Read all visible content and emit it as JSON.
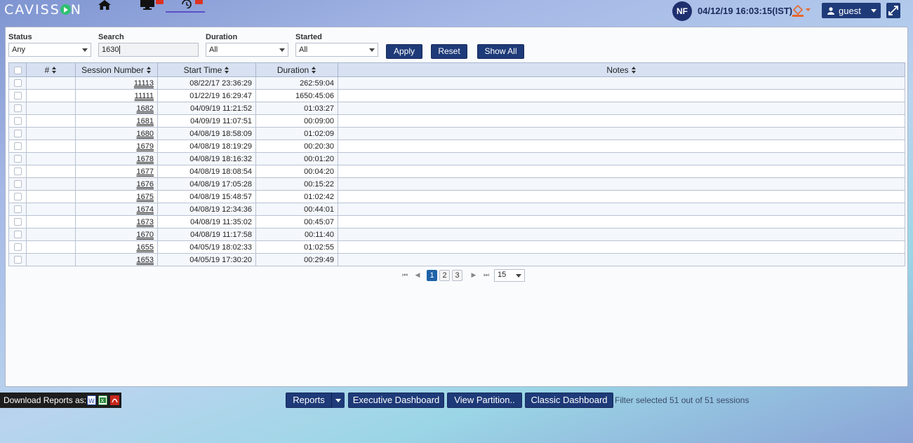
{
  "app": {
    "logo_text": "CAVISS",
    "logo_text_end": "N"
  },
  "header": {
    "avatar_initials": "NF",
    "datetime": "04/12/19 16:03:15(IST)",
    "user_label": "guest"
  },
  "filters": {
    "status": {
      "label": "Status",
      "value": "Any"
    },
    "search": {
      "label": "Search",
      "value": "1630"
    },
    "duration": {
      "label": "Duration",
      "value": "All"
    },
    "started": {
      "label": "Started",
      "value": "All"
    },
    "buttons": {
      "apply": "Apply",
      "reset": "Reset",
      "show_all": "Show All"
    }
  },
  "table": {
    "headers": {
      "index": "#",
      "session": "Session Number",
      "start": "Start Time",
      "duration": "Duration",
      "notes": "Notes"
    },
    "rows": [
      {
        "session": "11113",
        "start": "08/22/17 23:36:29",
        "duration": "262:59:04",
        "notes": ""
      },
      {
        "session": "11111",
        "start": "01/22/19 16:29:47",
        "duration": "1650:45:06",
        "notes": ""
      },
      {
        "session": "1682",
        "start": "04/09/19 11:21:52",
        "duration": "01:03:27",
        "notes": ""
      },
      {
        "session": "1681",
        "start": "04/09/19 11:07:51",
        "duration": "00:09:00",
        "notes": ""
      },
      {
        "session": "1680",
        "start": "04/08/19 18:58:09",
        "duration": "01:02:09",
        "notes": ""
      },
      {
        "session": "1679",
        "start": "04/08/19 18:19:29",
        "duration": "00:20:30",
        "notes": ""
      },
      {
        "session": "1678",
        "start": "04/08/19 18:16:32",
        "duration": "00:01:20",
        "notes": ""
      },
      {
        "session": "1677",
        "start": "04/08/19 18:08:54",
        "duration": "00:04:20",
        "notes": ""
      },
      {
        "session": "1676",
        "start": "04/08/19 17:05:28",
        "duration": "00:15:22",
        "notes": ""
      },
      {
        "session": "1675",
        "start": "04/08/19 15:48:57",
        "duration": "01:02:42",
        "notes": ""
      },
      {
        "session": "1674",
        "start": "04/08/19 12:34:36",
        "duration": "00:44:01",
        "notes": ""
      },
      {
        "session": "1673",
        "start": "04/08/19 11:35:02",
        "duration": "00:45:07",
        "notes": ""
      },
      {
        "session": "1670",
        "start": "04/08/19 11:17:58",
        "duration": "00:11:40",
        "notes": ""
      },
      {
        "session": "1655",
        "start": "04/05/19 18:02:33",
        "duration": "01:02:55",
        "notes": ""
      },
      {
        "session": "1653",
        "start": "04/05/19 17:30:20",
        "duration": "00:29:49",
        "notes": ""
      }
    ]
  },
  "pagination": {
    "pages": [
      "1",
      "2",
      "3"
    ],
    "current": "1",
    "page_size": "15"
  },
  "footer": {
    "download_label": "Download Reports as:",
    "reports": "Reports",
    "executive_dashboard": "Executive Dashboard",
    "view_partition": "View Partition..",
    "classic_dashboard": "Classic Dashboard",
    "filter_text": "Filter selected 51 out of 51 sessions"
  },
  "colors": {
    "primary": "#1e3a78",
    "accent_green": "#2fbf71",
    "header_row": "#d7e1f1"
  },
  "icons": [
    "home-icon",
    "monitor-icon",
    "history-clock-icon",
    "paint-bucket-icon",
    "user-icon",
    "expand-icon",
    "word-file-icon",
    "excel-file-icon",
    "pdf-file-icon"
  ]
}
